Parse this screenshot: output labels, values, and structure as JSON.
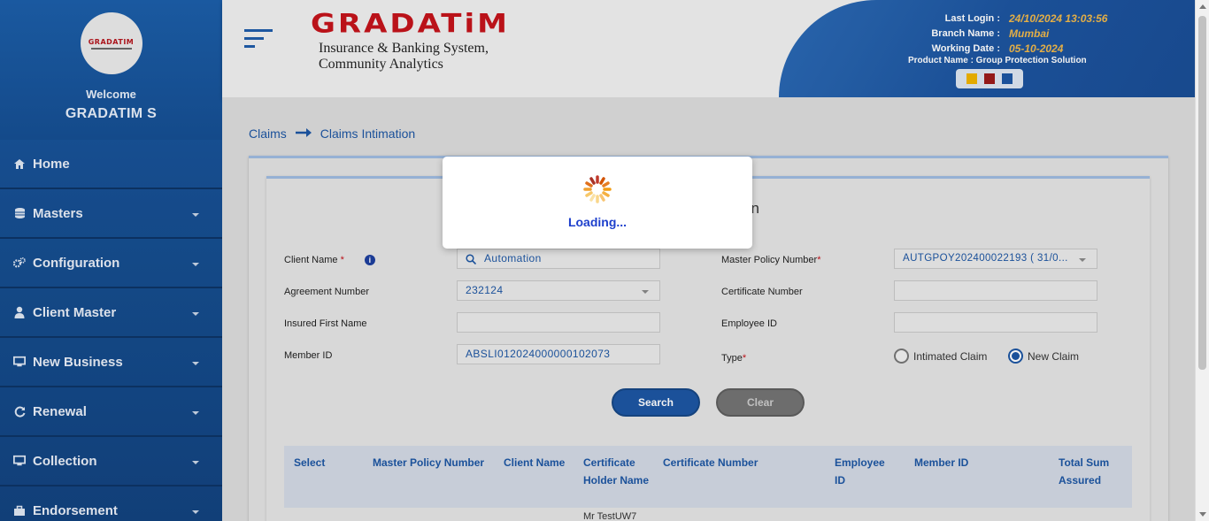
{
  "sidebar": {
    "logo_text": "GRADATIM",
    "welcome": "Welcome",
    "username": "GRADATIM S",
    "items": [
      {
        "label": "Home",
        "icon": "home-icon"
      },
      {
        "label": "Masters",
        "icon": "database-icon"
      },
      {
        "label": "Configuration",
        "icon": "gears-icon"
      },
      {
        "label": "Client Master",
        "icon": "user-icon"
      },
      {
        "label": "New Business",
        "icon": "monitor-icon"
      },
      {
        "label": "Renewal",
        "icon": "refresh-icon"
      },
      {
        "label": "Collection",
        "icon": "monitor-icon"
      },
      {
        "label": "Endorsement",
        "icon": "briefcase-icon"
      }
    ]
  },
  "header": {
    "brand_title": "GRADATiM",
    "brand_subtitle": "Insurance & Banking System, Community Analytics",
    "last_login_label": "Last Login :",
    "last_login_value": "24/10/2024 13:03:56",
    "branch_label": "Branch Name :",
    "branch_value": "Mumbai",
    "working_date_label": "Working Date :",
    "working_date_value": "05-10-2024",
    "product_name": "Product Name : Group Protection Solution",
    "theme_colors": [
      "#f0b400",
      "#9b1b1b",
      "#1d56a3"
    ]
  },
  "breadcrumb": {
    "parent": "Claims",
    "current": "Claims Intimation"
  },
  "form": {
    "title_partial": "on",
    "client_name_label": "Client Name",
    "client_name_value": "Automation",
    "master_policy_label": "Master Policy Number",
    "master_policy_value": "AUTGPOY202400022193 ( 31/0...",
    "agreement_label": "Agreement Number",
    "agreement_value": "232124",
    "certificate_label": "Certificate Number",
    "certificate_value": "",
    "insured_first_name_label": "Insured First Name",
    "insured_first_name_value": "",
    "employee_id_label": "Employee ID",
    "employee_id_value": "",
    "member_id_label": "Member ID",
    "member_id_value": "ABSLI012024000000102073",
    "type_label": "Type",
    "type_options": [
      "Intimated Claim",
      "New Claim"
    ],
    "type_selected": "New Claim",
    "search_button": "Search",
    "clear_button": "Clear"
  },
  "table": {
    "columns": [
      "Select",
      "Master Policy Number",
      "Client Name",
      "Certificate Holder Name",
      "Certificate Number",
      "Employee ID",
      "Member ID",
      "Total Sum Assured"
    ],
    "first_row_holder": "Mr TestUW7"
  },
  "modal": {
    "loading_text": "Loading..."
  }
}
